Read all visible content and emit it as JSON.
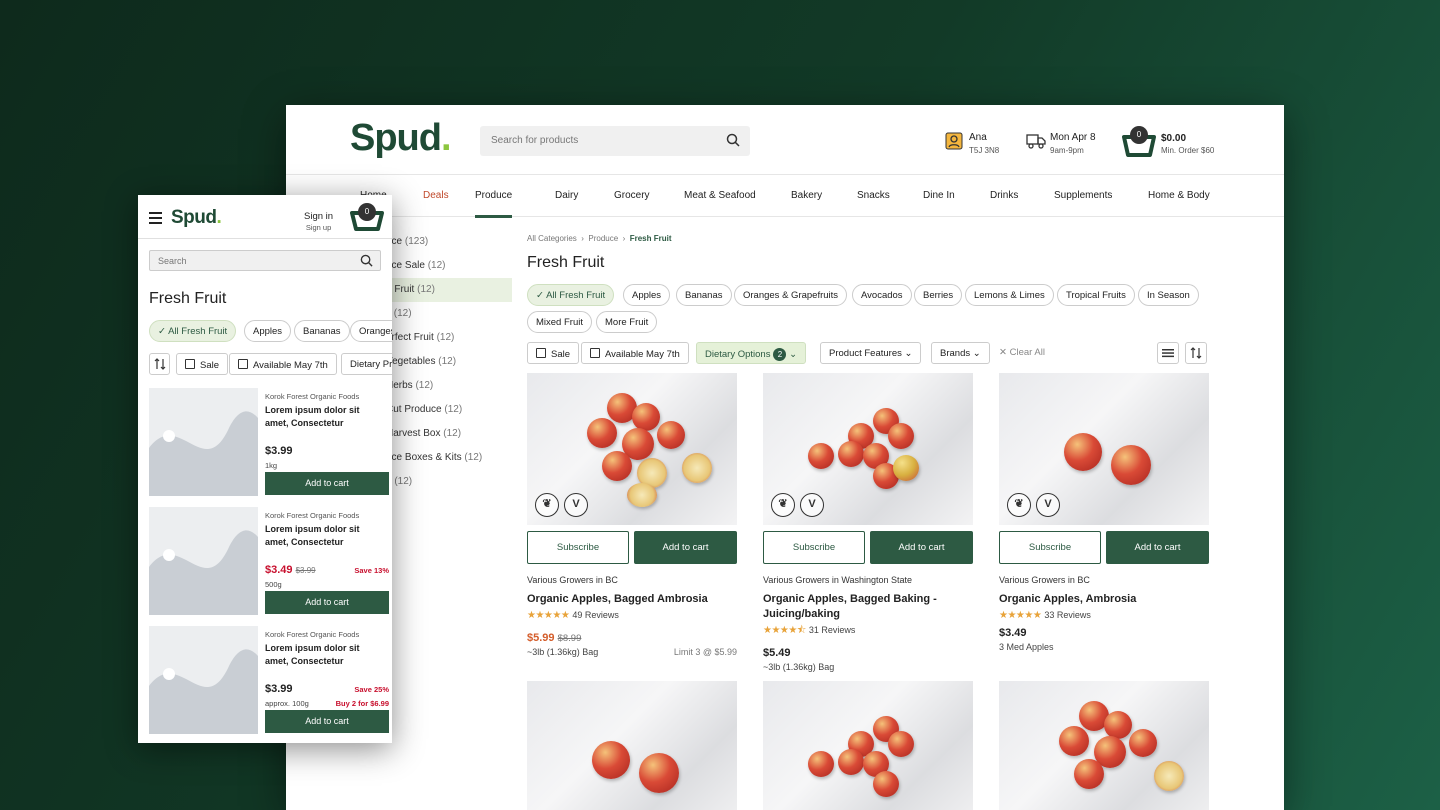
{
  "desktop": {
    "brand": {
      "name": "Spud",
      "dot": "."
    },
    "search": {
      "placeholder": "Search for products"
    },
    "user": {
      "name": "Ana",
      "postal": "T5J 3N8"
    },
    "delivery": {
      "date": "Mon Apr 8",
      "window": "9am-9pm"
    },
    "cart": {
      "count": "0",
      "total": "$0.00",
      "min_order": "Min. Order $60"
    },
    "nav": [
      "Home",
      "Deals",
      "Produce",
      "Dairy",
      "Grocery",
      "Meat & Seafood",
      "Bakery",
      "Snacks",
      "Dine In",
      "Drinks",
      "Supplements",
      "Home & Body"
    ],
    "sidebar": [
      {
        "label": "uce",
        "count": "(123)"
      },
      {
        "label": "uce Sale",
        "count": "(12)"
      },
      {
        "label": "n Fruit",
        "count": "(12)"
      },
      {
        "label": "it",
        "count": "(12)"
      },
      {
        "label": "erfect Fruit",
        "count": "(12)"
      },
      {
        "label": "Vegetables",
        "count": "(12)"
      },
      {
        "label": "Herbs",
        "count": "(12)"
      },
      {
        "label": "Cut Produce",
        "count": "(12)"
      },
      {
        "label": "Harvest Box",
        "count": "(12)"
      },
      {
        "label": "uce Boxes & Kits",
        "count": "(12)"
      },
      {
        "label": "n",
        "count": "(12)"
      }
    ],
    "breadcrumb": [
      "All Categories",
      "Produce",
      "Fresh Fruit"
    ],
    "title": "Fresh Fruit",
    "chips": [
      "All Fresh Fruit",
      "Apples",
      "Bananas",
      "Oranges & Grapefruits",
      "Avocados",
      "Berries",
      "Lemons & Limes",
      "Tropical Fruits",
      "In Season",
      "Mixed Fruit",
      "More Fruit"
    ],
    "filters": {
      "sale": "Sale",
      "available": "Available May 7th",
      "dietary": "Dietary Options",
      "dietary_count": "2",
      "features": "Product Features",
      "brands": "Brands",
      "clear": "Clear All"
    },
    "card_labels": {
      "subscribe": "Subscribe",
      "add": "Add to cart",
      "badge_v": "V"
    },
    "products": [
      {
        "grower": "Various Growers in BC",
        "name": "Organic Apples, Bagged Ambrosia",
        "stars": "★★★★★",
        "reviews": "49 Reviews",
        "price": "$5.99",
        "old": "$8.99",
        "size": "~3lb (1.36kg) Bag",
        "limit": "Limit 3 @ $5.99"
      },
      {
        "grower": "Various Growers in Washington State",
        "name": "Organic Apples, Bagged Baking - Juicing/baking",
        "stars": "★★★★⯪",
        "reviews": "31 Reviews",
        "price": "$5.49",
        "size": "~3lb (1.36kg) Bag"
      },
      {
        "grower": "Various Growers in BC",
        "name": "Organic Apples, Ambrosia",
        "stars": "★★★★★",
        "reviews": "33 Reviews",
        "price": "$3.49",
        "size": "3 Med Apples"
      }
    ]
  },
  "mobile": {
    "brand": {
      "name": "Spud",
      "dot": "."
    },
    "sign_in": "Sign in",
    "sign_up": "Sign up",
    "cart_count": "0",
    "search_placeholder": "Search",
    "title": "Fresh Fruit",
    "chips": [
      "All Fresh Fruit",
      "Apples",
      "Bananas",
      "Oranges"
    ],
    "filters": {
      "sale": "Sale",
      "available": "Available May 7th",
      "dietary": "Dietary Pr"
    },
    "items": [
      {
        "brand": "Korok Forest Organic Foods",
        "name": "Lorem ipsum dolor sit amet, Consectetur",
        "price": "$3.99",
        "size": "1kg",
        "add": "Add to cart"
      },
      {
        "brand": "Korok Forest Organic Foods",
        "name": "Lorem ipsum dolor sit amet, Consectetur",
        "price": "$3.49",
        "old": "$3.99",
        "save": "Save 13%",
        "size": "500g",
        "add": "Add to cart"
      },
      {
        "brand": "Korok Forest Organic Foods",
        "name": "Lorem ipsum dolor sit amet, Consectetur",
        "price": "$3.99",
        "save": "Save 25%",
        "size": "approx. 100g",
        "buy": "Buy 2 for $6.99",
        "add": "Add to cart"
      }
    ]
  },
  "colors": {
    "brand_green": "#2d5a43",
    "accent_lime": "#8cc63f",
    "sale": "#d45d2b",
    "save_red": "#c8102e"
  }
}
